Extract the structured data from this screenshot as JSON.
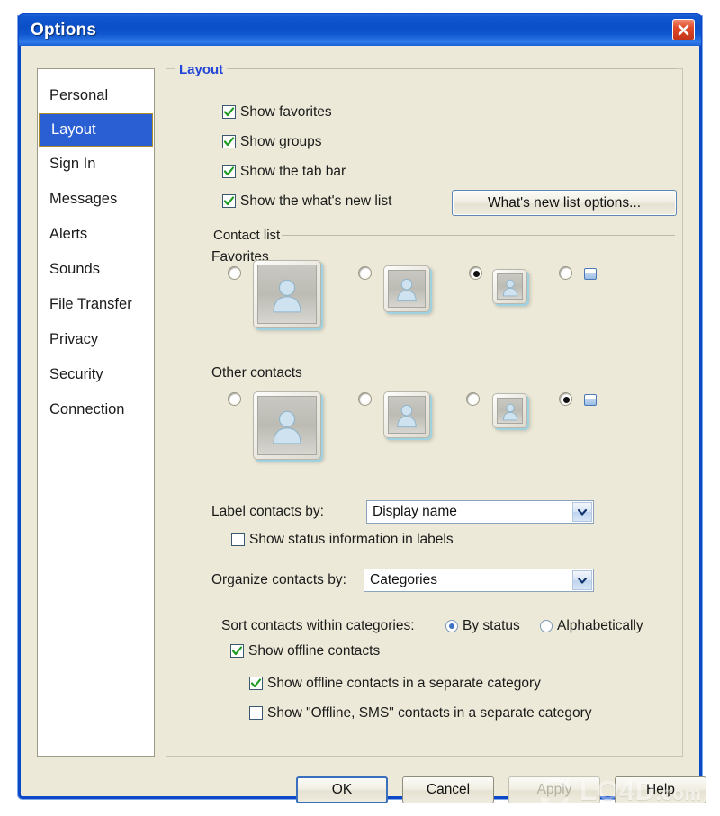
{
  "window": {
    "title": "Options",
    "close_icon": "close-icon"
  },
  "sidebar": {
    "items": [
      {
        "label": "Personal",
        "selected": false
      },
      {
        "label": "Layout",
        "selected": true
      },
      {
        "label": "Sign In",
        "selected": false
      },
      {
        "label": "Messages",
        "selected": false
      },
      {
        "label": "Alerts",
        "selected": false
      },
      {
        "label": "Sounds",
        "selected": false
      },
      {
        "label": "File Transfer",
        "selected": false
      },
      {
        "label": "Privacy",
        "selected": false
      },
      {
        "label": "Security",
        "selected": false
      },
      {
        "label": "Connection",
        "selected": false
      }
    ]
  },
  "layout_group": {
    "legend": "Layout",
    "checkboxes": [
      {
        "label": "Show favorites",
        "checked": true
      },
      {
        "label": "Show groups",
        "checked": true
      },
      {
        "label": "Show the tab bar",
        "checked": true
      },
      {
        "label": "Show the what's new list",
        "checked": true
      }
    ],
    "whats_new_button": "What's new list options..."
  },
  "contact_list": {
    "legend": "Contact list",
    "favorites": {
      "label": "Favorites",
      "selected_index": 2,
      "options": [
        "large-avatar",
        "medium-avatar",
        "small-avatar",
        "no-avatar"
      ]
    },
    "other_contacts": {
      "label": "Other contacts",
      "selected_index": 3,
      "options": [
        "large-avatar",
        "medium-avatar",
        "small-avatar",
        "no-avatar"
      ]
    },
    "label_contacts_by": {
      "label": "Label contacts by:",
      "value": "Display name"
    },
    "show_status_in_labels": {
      "label": "Show status information in labels",
      "checked": false
    },
    "organize_contacts_by": {
      "label": "Organize contacts by:",
      "value": "Categories"
    },
    "sort_within_categories": {
      "label": "Sort contacts within categories:",
      "options": [
        {
          "label": "By status",
          "selected": true
        },
        {
          "label": "Alphabetically",
          "selected": false
        }
      ]
    },
    "show_offline": {
      "label": "Show offline contacts",
      "checked": true
    },
    "show_offline_separate": {
      "label": "Show offline contacts in a separate category",
      "checked": true
    },
    "show_offline_sms_separate": {
      "label": "Show \"Offline, SMS\" contacts in a separate category",
      "checked": false
    }
  },
  "footer": {
    "ok": "OK",
    "cancel": "Cancel",
    "apply": "Apply",
    "help": "Help"
  },
  "watermark": {
    "name": "LO4D",
    "suffix": ".com"
  },
  "colors": {
    "titlebar_blue": "#0a4fc8",
    "dialog_bg": "#ece9d8",
    "selection_blue": "#2a5fd4",
    "group_legend_blue": "#2346d8",
    "check_green": "#1e9b23",
    "close_red": "#c2341a"
  }
}
